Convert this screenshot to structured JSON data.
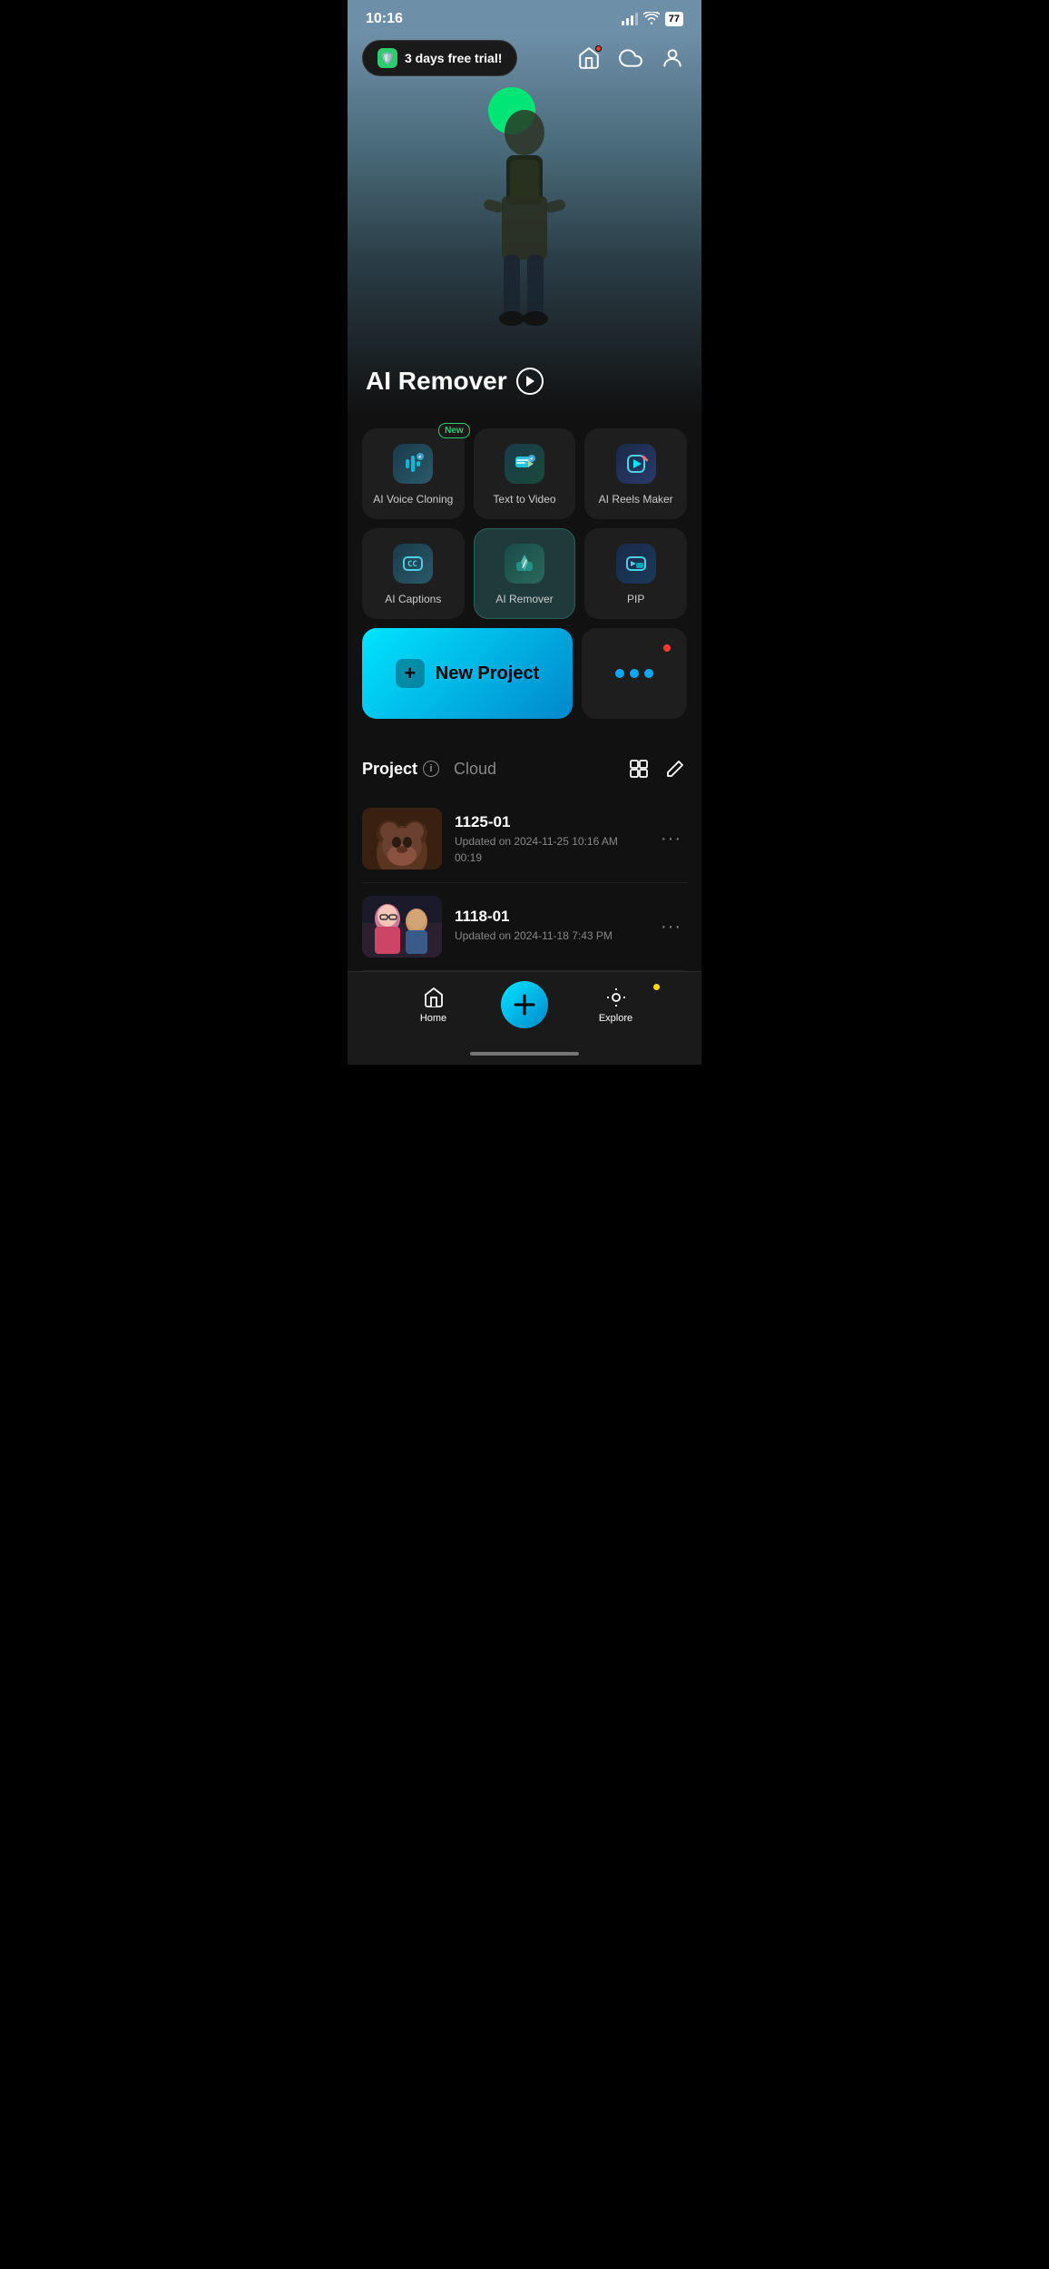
{
  "statusBar": {
    "time": "10:16",
    "battery": "77"
  },
  "topBar": {
    "trialBadge": "3 days free trial!",
    "badgeEmoji": "🛡️"
  },
  "hero": {
    "title": "AI Remover",
    "playLabel": "▶"
  },
  "tools": [
    {
      "id": "voice-cloning",
      "label": "AI Voice Cloning",
      "isNew": true,
      "iconType": "voice"
    },
    {
      "id": "text-to-video",
      "label": "Text  to Video",
      "isNew": false,
      "iconType": "text-video"
    },
    {
      "id": "ai-reels",
      "label": "AI Reels Maker",
      "isNew": false,
      "iconType": "reels"
    },
    {
      "id": "ai-captions",
      "label": "AI Captions",
      "isNew": false,
      "iconType": "captions"
    },
    {
      "id": "ai-remover",
      "label": "AI Remover",
      "isNew": false,
      "iconType": "remover",
      "highlighted": true
    },
    {
      "id": "pip",
      "label": "PIP",
      "isNew": false,
      "iconType": "pip"
    }
  ],
  "newProject": {
    "label": "New Project"
  },
  "projects": {
    "tabs": [
      {
        "label": "Project",
        "active": true
      },
      {
        "label": "Cloud",
        "active": false
      }
    ],
    "items": [
      {
        "id": "1125-01",
        "name": "1125-01",
        "date": "Updated on 2024-11-25 10:16 AM",
        "duration": "00:19",
        "thumbType": "bear"
      },
      {
        "id": "1118-01",
        "name": "1118-01",
        "date": "Updated on 2024-11-18 7:43 PM",
        "duration": "",
        "thumbType": "people"
      }
    ]
  },
  "bottomNav": {
    "homeLabel": "Home",
    "exploreLabel": "Explore"
  }
}
